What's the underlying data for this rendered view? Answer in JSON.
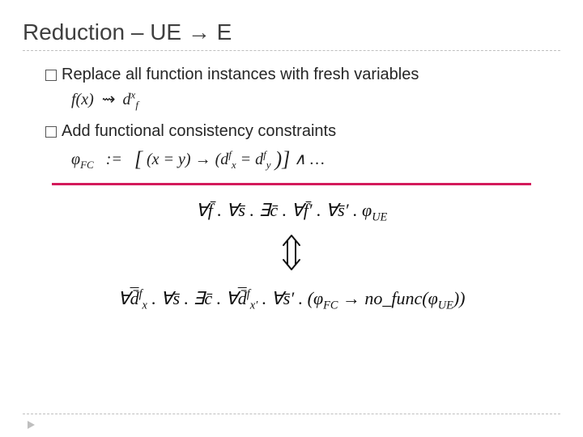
{
  "title": "Reduction – UE → E",
  "bullets": {
    "b1_prefix": "Replace",
    "b1_rest": " all function instances with fresh variables",
    "b2_prefix": "Add",
    "b2_rest": " functional consistency constraints"
  },
  "formulas": {
    "rewrite_lhs": "f(x)",
    "rewrite_arrow": "⇝",
    "rewrite_rhs_base": "d",
    "rewrite_rhs_sup": "x",
    "rewrite_rhs_sub": "f",
    "phi_fc": "φ",
    "phi_fc_sub": "FC",
    "def_sym": ":=",
    "fc_body_open": "[",
    "fc_body_eq_lhs": "(x = y)",
    "fc_body_arrow": " → ",
    "fc_body_eq_rhs_open": "(d",
    "fc_body_dxf_sup": "f",
    "fc_body_dxf_sub": "x",
    "fc_body_eq_mid": " = d",
    "fc_body_dyf_sup": "f",
    "fc_body_dyf_sub": "y",
    "fc_body_close": ")]",
    "fc_tail": " ∧ …",
    "top_chain_1": "∀f̄ . ∀s̄ . ∃c̄ . ∀f̄′ . ∀s̄′ . φ",
    "top_chain_1_sub": "UE",
    "bot_chain_pre": "∀",
    "bot_dfx": "d̄",
    "bot_dfx_sup": "f",
    "bot_dfx_sub": "x",
    "bot_seg2": " . ∀s̄ . ∃c̄ . ∀",
    "bot_dfx2": "d̄",
    "bot_dfx2_sup": "f",
    "bot_dfx2_sub": "x′",
    "bot_seg3": " . ∀s̄′ . (φ",
    "bot_phi_fc_sub": "FC",
    "bot_seg4": " → no_func(φ",
    "bot_phi_ue_sub": "UE",
    "bot_seg5": "))"
  }
}
